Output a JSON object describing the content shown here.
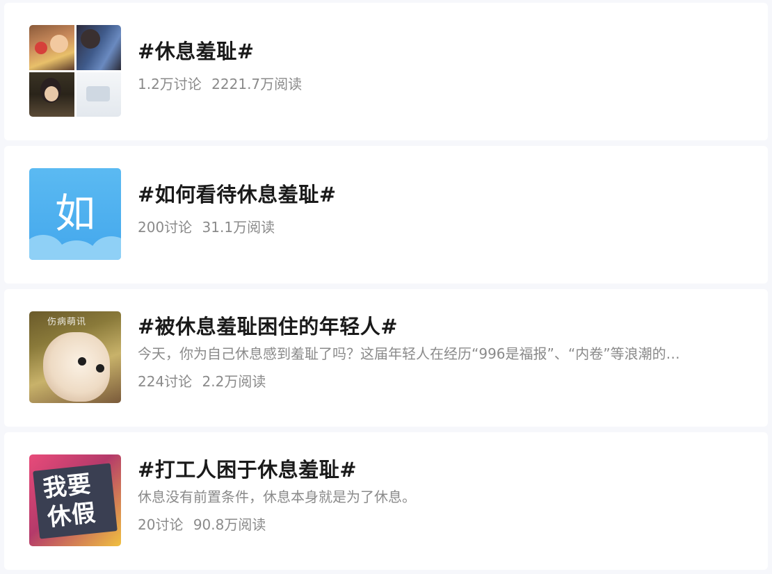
{
  "topics": [
    {
      "title": "#休息羞耻#",
      "description": "",
      "discussions": "1.2万讨论",
      "reads": "2221.7万阅读",
      "thumbnail": "photo-collage"
    },
    {
      "title": "#如何看待休息羞耻#",
      "description": "",
      "discussions": "200讨论",
      "reads": "31.1万阅读",
      "thumbnail": "blue-icon",
      "thumbnail_text": "如"
    },
    {
      "title": "#被休息羞耻困住的年轻人#",
      "description": "今天，你为自己休息感到羞耻了吗？这届年轻人在经历“996是福报”、“内卷”等浪潮的…",
      "discussions": "224讨论",
      "reads": "2.2万阅读",
      "thumbnail": "cat-photo",
      "thumbnail_text": "伤病萌讯"
    },
    {
      "title": "#打工人困于休息羞耻#",
      "description": "休息没有前置条件，休息本身就是为了休息。",
      "discussions": "20讨论",
      "reads": "90.8万阅读",
      "thumbnail": "holiday-sign",
      "thumbnail_text_line1": "我要",
      "thumbnail_text_line2": "休假"
    }
  ],
  "colors": {
    "background": "#f6f7fb",
    "card": "#ffffff",
    "title": "#1a1a1a",
    "meta": "#8a8a8a",
    "icon_blue": "#4aaeee"
  }
}
